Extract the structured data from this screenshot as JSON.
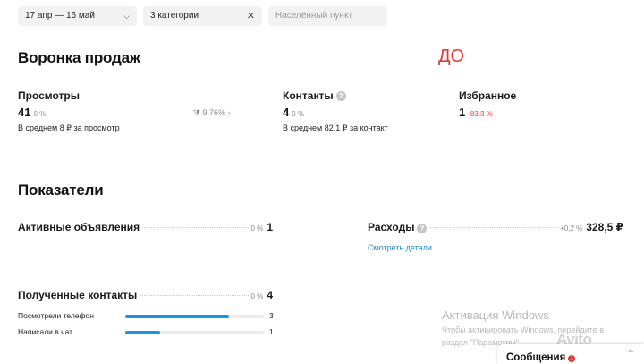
{
  "filters": {
    "date_range": "17 апр — 16 май",
    "categories": "3 категории",
    "location_placeholder": "Населённый пункт"
  },
  "funnel": {
    "title": "Воронка продаж",
    "before_label": "ДО",
    "views": {
      "label": "Просмотры",
      "value": "41",
      "pct": "0 %",
      "sub": "В среднем 8 ₽ за просмотр"
    },
    "conversion": "9,76%",
    "contacts": {
      "label": "Контакты",
      "value": "4",
      "pct": "0 %",
      "sub": "В среднем 82,1 ₽ за контакт"
    },
    "favorites": {
      "label": "Избранное",
      "value": "1",
      "pct": "-83,3 %"
    }
  },
  "indicators": {
    "title": "Показатели",
    "active_ads": {
      "label": "Активные объявления",
      "pct": "0 %",
      "value": "1"
    },
    "expenses": {
      "label": "Расходы",
      "pct": "+0,2 %",
      "value": "328,5 ₽",
      "details_link": "Смотреть детали"
    },
    "received_contacts": {
      "label": "Полученные контакты",
      "pct": "0 %",
      "value": "4",
      "breakdown": [
        {
          "label": "Посмотрели телефон",
          "value": "3",
          "fraction": 0.75
        },
        {
          "label": "Написали в чат",
          "value": "1",
          "fraction": 0.25
        }
      ]
    }
  },
  "watermark": {
    "title": "Активация Windows",
    "line1": "Чтобы активировать Windows, перейдите в",
    "line2": "раздел \"Параметры\"."
  },
  "logo_text": "Avito",
  "messages": {
    "label": "Сообщения",
    "unread_count": "1"
  }
}
